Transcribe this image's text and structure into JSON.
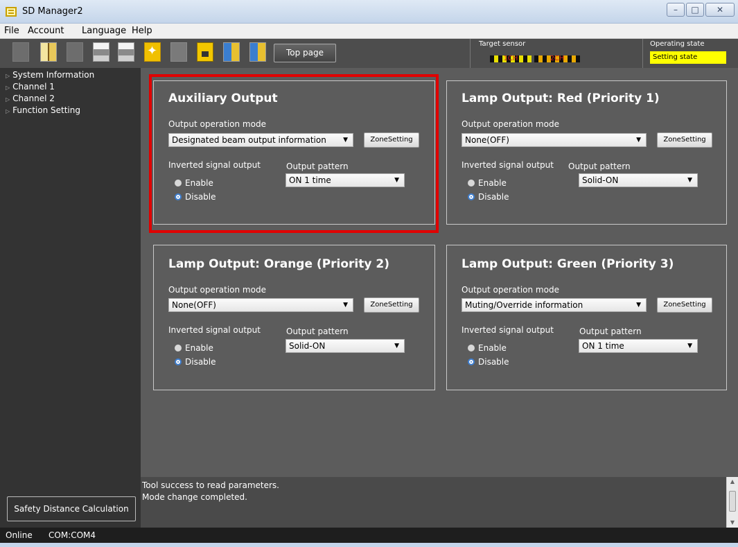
{
  "window": {
    "title": "SD Manager2",
    "minimize": "–",
    "maximize": "□",
    "close": "✕"
  },
  "menu": [
    "File",
    "Account",
    "Language",
    "Help"
  ],
  "toolbar": {
    "top_page_label": "Top page",
    "target_sensor_label": "Target sensor",
    "ch1_label": "1CH",
    "ch2_label": "2CH",
    "operating_state_label": "Operating state",
    "operating_state_value": "Setting state",
    "operating_state_color": "#ffff00"
  },
  "sidebar": {
    "items": [
      "System Information",
      "Channel 1",
      "Channel 2",
      "Function Setting"
    ],
    "safety_button": "Safety Distance Calculation"
  },
  "common": {
    "mode_label": "Output operation mode",
    "zone_button": "ZoneSetting",
    "inverted_label": "Inverted signal output",
    "pattern_label": "Output pattern",
    "enable_label": "Enable",
    "disable_label": "Disable"
  },
  "panels": [
    {
      "title": "Auxiliary Output",
      "mode": "Designated beam output information",
      "pattern": "ON 1 time",
      "inverted": "Disable",
      "highlighted": true
    },
    {
      "title": "Lamp Output: Red (Priority 1)",
      "mode": "None(OFF)",
      "pattern": "Solid-ON",
      "inverted": "Disable"
    },
    {
      "title": "Lamp Output: Orange (Priority 2)",
      "mode": "None(OFF)",
      "pattern": "Solid-ON",
      "inverted": "Disable"
    },
    {
      "title": "Lamp Output: Green (Priority 3)",
      "mode": "Muting/Override information",
      "pattern": "ON 1 time",
      "inverted": "Disable"
    }
  ],
  "log": [
    "Tool success to read parameters.",
    "Mode change completed."
  ],
  "status": {
    "connection": "Online",
    "port": "COM:COM4"
  },
  "colors": {
    "highlight": "#e00000",
    "main_bg": "#5c5c5c",
    "sidebar_bg": "#333333"
  }
}
